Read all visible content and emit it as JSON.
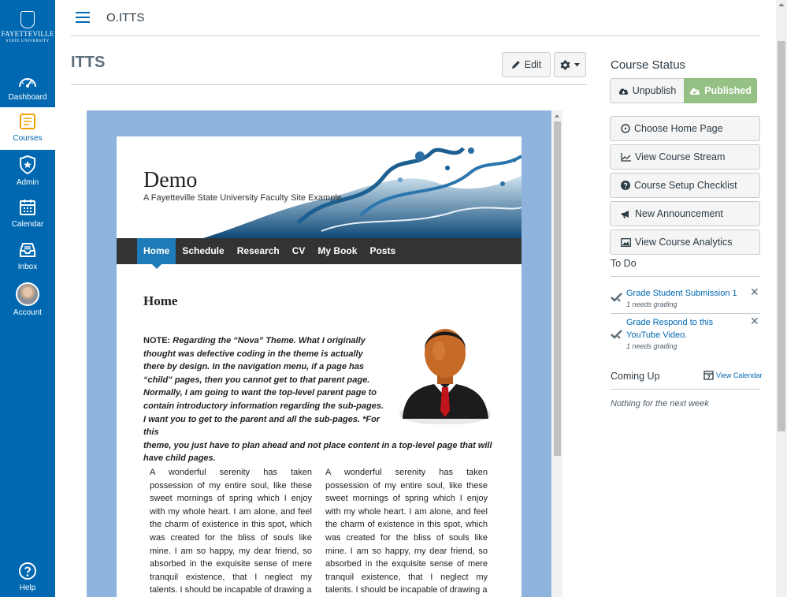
{
  "global_nav": {
    "logo_line1": "FAYETTEVILLE",
    "logo_line2": "STATE UNIVERSITY",
    "items": [
      {
        "label": "Dashboard",
        "icon": "dashboard-icon"
      },
      {
        "label": "Courses",
        "icon": "courses-icon",
        "active": true
      },
      {
        "label": "Admin",
        "icon": "admin-shield-icon"
      },
      {
        "label": "Calendar",
        "icon": "calendar-icon"
      },
      {
        "label": "Inbox",
        "icon": "inbox-icon"
      },
      {
        "label": "Account",
        "icon": "account-avatar"
      },
      {
        "label": "Help",
        "icon": "help-icon"
      }
    ],
    "colors": {
      "nav_bg": "#0067b1",
      "active_bg": "#ffffff"
    }
  },
  "topbar": {
    "breadcrumb": "O.ITTS"
  },
  "page": {
    "title": "ITTS",
    "edit_label": "Edit",
    "embedded": {
      "site_title": "Demo",
      "site_subtitle": "A Fayetteville State University Faculty Site Example",
      "menu": [
        "Home",
        "Schedule",
        "Research",
        "CV",
        "My Book",
        "Posts"
      ],
      "active_menu": "Home",
      "heading": "Home",
      "note_lead": "NOTE:",
      "note_part1": "Regarding the “Nova” Theme.  What I originally thought was defective coding in the theme is actually there by design.  In the navigation menu, if a page has “child” pages, then you cannot get to that parent page.  Normally, I am going to want the top-level parent page to contain introductory information regarding the sub-pages.  I want you to get to the parent and all the sub-pages.  *For this",
      "note_part2": "theme, you just have to plan ahead and not place content in a top-level page that will have child pages.",
      "column_text": "A wonderful serenity has taken possession of my entire soul, like these sweet mornings of spring which I enjoy with my whole heart. I am alone, and feel the charm of existence in this spot, which was created for the bliss of souls like mine. I am so happy, my dear friend, so absorbed in the exquisite sense of mere tranquil existence, that I neglect my talents. I should be incapable of drawing a"
    }
  },
  "sidebar": {
    "status_title": "Course Status",
    "unpublish_label": "Unpublish",
    "published_label": "Published",
    "buttons": [
      {
        "label": "Choose Home Page",
        "icon": "circle-dot-icon"
      },
      {
        "label": "View Course Stream",
        "icon": "line-chart-icon"
      },
      {
        "label": "Course Setup Checklist",
        "icon": "question-circle-icon"
      },
      {
        "label": "New Announcement",
        "icon": "megaphone-icon"
      },
      {
        "label": "View Course Analytics",
        "icon": "analytics-image-icon"
      }
    ],
    "todo_title": "To Do",
    "todos": [
      {
        "title": "Grade Student Submission 1",
        "sub": "1 needs grading"
      },
      {
        "title": "Grade Respond to this YouTube Video.",
        "sub": "1 needs grading"
      }
    ],
    "coming_up_title": "Coming Up",
    "view_calendar": "View Calendar",
    "nothing": "Nothing for the next week",
    "colors": {
      "published_green": "#95c185",
      "link_blue": "#0067b1"
    }
  }
}
